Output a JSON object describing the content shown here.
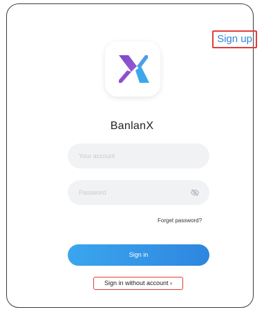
{
  "header": {
    "signup_label": "Sign up"
  },
  "app": {
    "name": "BanlanX",
    "logo_icon": "banlanx-x-logo",
    "logo_colors": [
      "#8a4fc8",
      "#4aa0e6"
    ]
  },
  "form": {
    "account_placeholder": "Your account",
    "account_value": "",
    "password_placeholder": "Password",
    "password_value": "",
    "password_toggle_icon": "eye-off-icon",
    "forgot_label": "Forget password?",
    "signin_label": "Sign in",
    "guest_label": "Sign in without account",
    "guest_chevron": "›"
  },
  "colors": {
    "accent": "#2f87d8",
    "highlight_border": "#e23b3b",
    "field_bg": "#f1f2f4"
  }
}
